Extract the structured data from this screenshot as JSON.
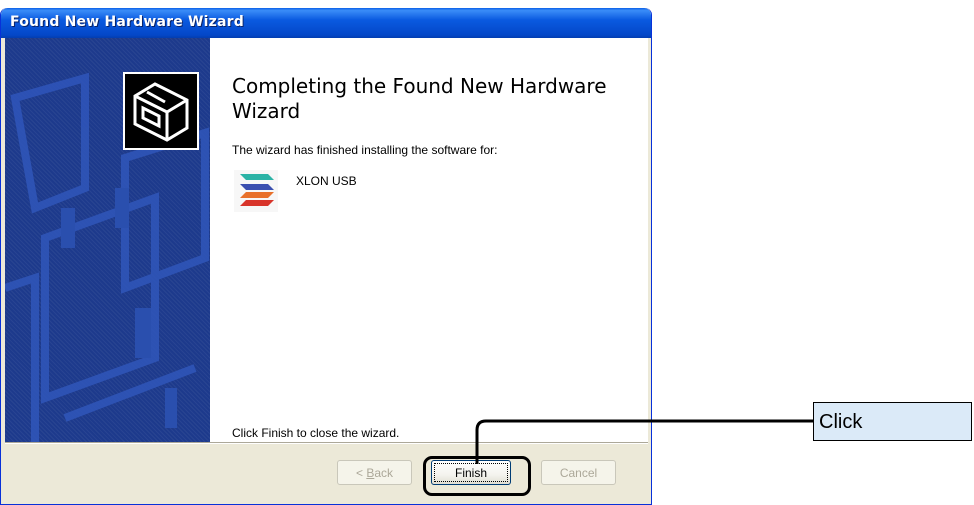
{
  "window": {
    "title": "Found New Hardware Wizard"
  },
  "content": {
    "heading": "Completing the Found New Hardware Wizard",
    "description": "The wizard has finished installing the software for:",
    "device_name": "XLON USB",
    "footer_text": "Click Finish to close the wizard."
  },
  "buttons": {
    "back_prefix": "< ",
    "back_mnemonic": "B",
    "back_rest": "ack",
    "finish": "Finish",
    "cancel": "Cancel"
  },
  "annotation": {
    "label": "Click"
  }
}
